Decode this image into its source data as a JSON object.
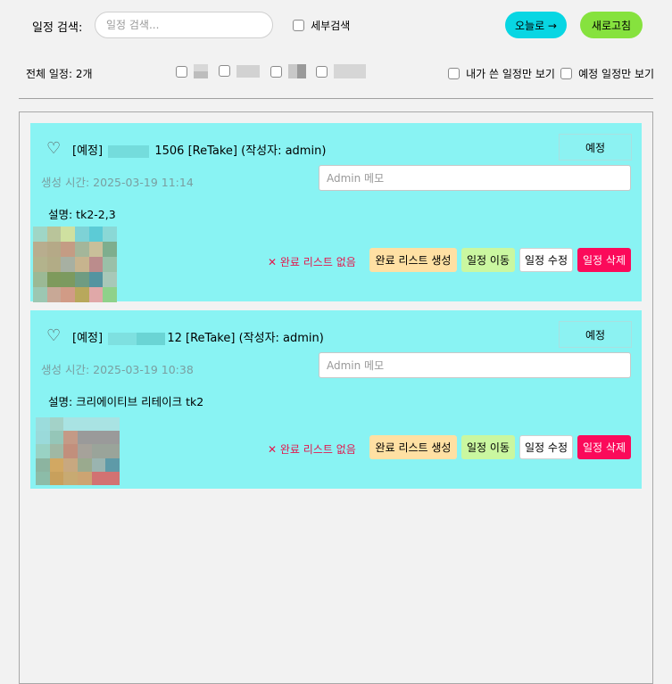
{
  "toolbar": {
    "search_label": "일정 검색:",
    "search_placeholder": "일정 검색...",
    "detail_search_label": "세부검색",
    "today_button": "오늘로 →",
    "refresh_button": "새로고침",
    "today_color": "#08d6e3",
    "refresh_color": "#86e23e"
  },
  "filters": {
    "total_label": "전체 일정: 2개",
    "mine_label": "내가 쓴 일정만 보기",
    "scheduled_label": "예정 일정만 보기"
  },
  "colors": {
    "card_bg": "#89f3f3",
    "complete_bg": "#ffe0a3",
    "move_bg": "#caf7a0",
    "delete_bg": "#fb0a5a",
    "none_text": "#e3174d"
  },
  "cards": [
    {
      "title_prefix": "[예정]",
      "title_suffix": "1506 [ReTake] (작성자: admin)",
      "status": "예정",
      "created": "생성 시간: 2025-03-19 11:14",
      "memo_placeholder": "Admin 메모",
      "description": "설명: tk2-2,3",
      "no_list": "✕ 완료 리스트 없음",
      "btn_create": "완료 리스트 생성",
      "btn_move": "일정 이동",
      "btn_edit": "일정 수정",
      "btn_delete": "일정 삭제"
    },
    {
      "title_prefix": "[예정]",
      "title_suffix": "12 [ReTake] (작성자: admin)",
      "status": "예정",
      "created": "생성 시간: 2025-03-19 10:38",
      "memo_placeholder": "Admin 메모",
      "description": "설명: 크리에이티브 리테이크 tk2",
      "no_list": "✕ 완료 리스트 없음",
      "btn_create": "완료 리스트 생성",
      "btn_move": "일정 이동",
      "btn_edit": "일정 수정",
      "btn_delete": "일정 삭제"
    }
  ]
}
